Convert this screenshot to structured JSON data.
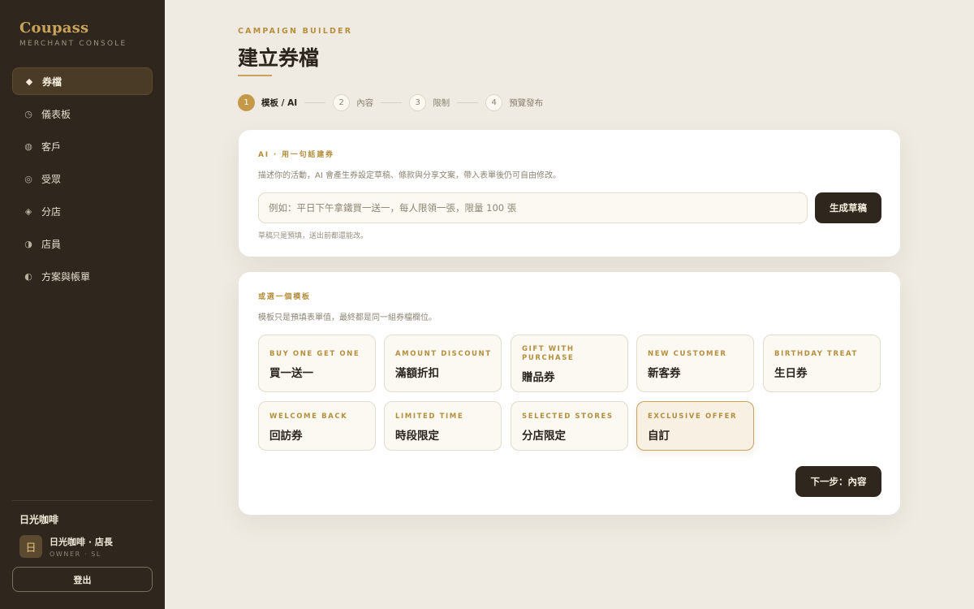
{
  "brand": {
    "name": "Coupass",
    "subtitle": "MERCHANT CONSOLE"
  },
  "sidebar": {
    "items": [
      {
        "label": "券檔",
        "icon": "diamond-icon",
        "glyph": "◆",
        "active": true
      },
      {
        "label": "儀表板",
        "icon": "clock-icon",
        "glyph": "◷",
        "active": false
      },
      {
        "label": "客戶",
        "icon": "dot-circle-icon",
        "glyph": "◍",
        "active": false
      },
      {
        "label": "受眾",
        "icon": "target-icon",
        "glyph": "◎",
        "active": false
      },
      {
        "label": "分店",
        "icon": "diamond-dot-icon",
        "glyph": "◈",
        "active": false
      },
      {
        "label": "店員",
        "icon": "half-circle-icon",
        "glyph": "◑",
        "active": false
      },
      {
        "label": "方案與帳單",
        "icon": "half-circle-left-icon",
        "glyph": "◐",
        "active": false
      }
    ],
    "store_name": "日光咖啡",
    "user": {
      "initial": "日",
      "name": "日光咖啡 · 店長",
      "role": "OWNER · SL"
    },
    "logout_label": "登出"
  },
  "header": {
    "eyebrow": "CAMPAIGN BUILDER",
    "title": "建立券檔"
  },
  "steps": [
    {
      "num": "1",
      "label": "模板 / AI",
      "active": true
    },
    {
      "num": "2",
      "label": "內容",
      "active": false
    },
    {
      "num": "3",
      "label": "限制",
      "active": false
    },
    {
      "num": "4",
      "label": "預覽發布",
      "active": false
    }
  ],
  "ai_card": {
    "eyebrow": "AI · 用一句話建券",
    "description": "描述你的活動，AI 會產生券設定草稿、條款與分享文案，帶入表單後仍可自由修改。",
    "input_value": "",
    "input_placeholder": "例如：平日下午拿鐵買一送一，每人限領一張，限量 100 張",
    "generate_label": "生成草稿",
    "hint": "草稿只是預填，送出前都還能改。"
  },
  "template_card": {
    "eyebrow": "或選一個模板",
    "description": "模板只是預填表單值，最終都是同一組券檔欄位。",
    "templates": [
      {
        "en": "BUY ONE GET ONE",
        "zh": "買一送一",
        "selected": false
      },
      {
        "en": "AMOUNT DISCOUNT",
        "zh": "滿額折扣",
        "selected": false
      },
      {
        "en": "GIFT WITH PURCHASE",
        "zh": "贈品券",
        "selected": false
      },
      {
        "en": "NEW CUSTOMER",
        "zh": "新客券",
        "selected": false
      },
      {
        "en": "BIRTHDAY TREAT",
        "zh": "生日券",
        "selected": false
      },
      {
        "en": "WELCOME BACK",
        "zh": "回訪券",
        "selected": false
      },
      {
        "en": "LIMITED TIME",
        "zh": "時段限定",
        "selected": false
      },
      {
        "en": "SELECTED STORES",
        "zh": "分店限定",
        "selected": false
      },
      {
        "en": "EXCLUSIVE OFFER",
        "zh": "自訂",
        "selected": true
      }
    ],
    "next_label": "下一步：內容"
  },
  "colors": {
    "accent": "#c49a48",
    "sidebar": "#2f271e",
    "background": "#efebe2",
    "card": "#ffffff"
  }
}
